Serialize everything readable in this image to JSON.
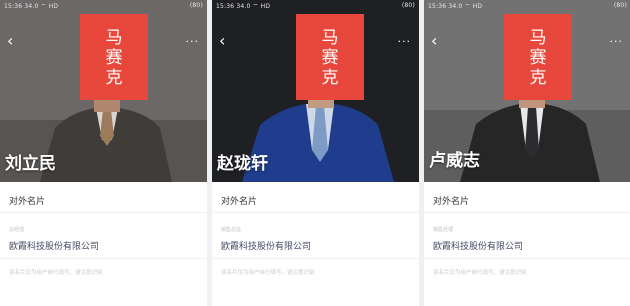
{
  "cards": [
    {
      "status_time": "15:36",
      "status_info": "34.0 ⌔ HD",
      "battery": "(80)",
      "mask_chars": [
        "马",
        "赛",
        "克"
      ],
      "name": "刘立民",
      "card_tag": "对外名片",
      "role": "总经理",
      "company": "欧霞科技股份有限公司",
      "description": "该名片仅为用户自行填写，请注意识别"
    },
    {
      "status_time": "15:36",
      "status_info": "34.0 ⌔ HD",
      "battery": "(80)",
      "mask_chars": [
        "马",
        "赛",
        "克"
      ],
      "name": "赵珑轩",
      "card_tag": "对外名片",
      "role": "销售总监",
      "company": "欧霞科技股份有限公司",
      "description": "该名片仅为用户自行填写，请注意识别"
    },
    {
      "status_time": "15:36",
      "status_info": "34.0 ⌔ HD",
      "battery": "(80)",
      "mask_chars": [
        "马",
        "赛",
        "克"
      ],
      "name": "卢威志",
      "card_tag": "对外名片",
      "role": "销售经理",
      "company": "欧霞科技股份有限公司",
      "description": "该名片仅为用户自行填写，请注意识别"
    }
  ],
  "icons": {
    "back": "back-arrow-icon",
    "more": "more-dots-icon"
  },
  "colors": {
    "mask": "#e8483b",
    "company": "#444a66"
  }
}
